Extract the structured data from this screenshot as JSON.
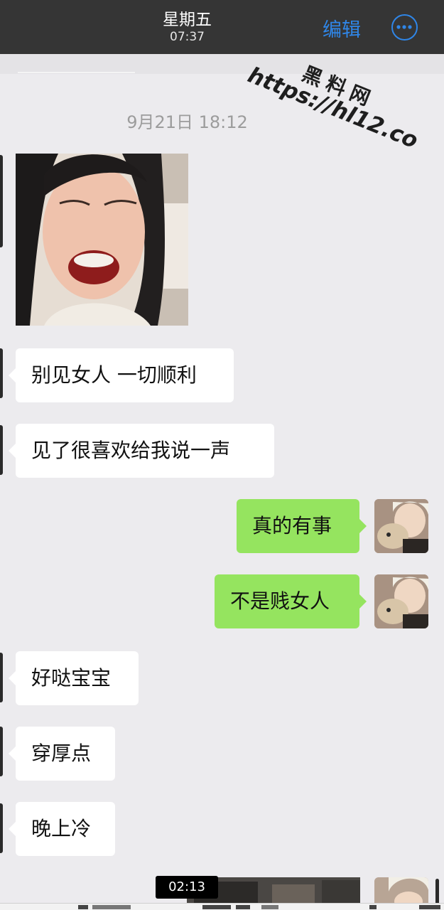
{
  "header": {
    "day": "星期五",
    "time": "07:37",
    "edit_label": "编辑",
    "more_icon": "more-circle-icon",
    "accent": "#2f86e8"
  },
  "watermark": {
    "cn": "黑料网",
    "url": "https://hl12.co"
  },
  "chat": {
    "date_stamp": "9月21日 18:12",
    "messages": [
      {
        "side": "left",
        "type": "image"
      },
      {
        "side": "left",
        "type": "text",
        "text": "别见女人 一切顺利"
      },
      {
        "side": "left",
        "type": "text",
        "text": "见了很喜欢给我说一声"
      },
      {
        "side": "right",
        "type": "text",
        "text": "真的有事"
      },
      {
        "side": "right",
        "type": "text",
        "text": "不是贱女人"
      },
      {
        "side": "left",
        "type": "text",
        "text": "好哒宝宝"
      },
      {
        "side": "left",
        "type": "text",
        "text": "穿厚点"
      },
      {
        "side": "left",
        "type": "text",
        "text": "晚上冷"
      },
      {
        "side": "right",
        "type": "image"
      }
    ],
    "colors": {
      "left_bubble": "#ffffff",
      "right_bubble": "#95e45f",
      "background": "#ecebee"
    }
  },
  "video": {
    "timer": "02:13"
  }
}
